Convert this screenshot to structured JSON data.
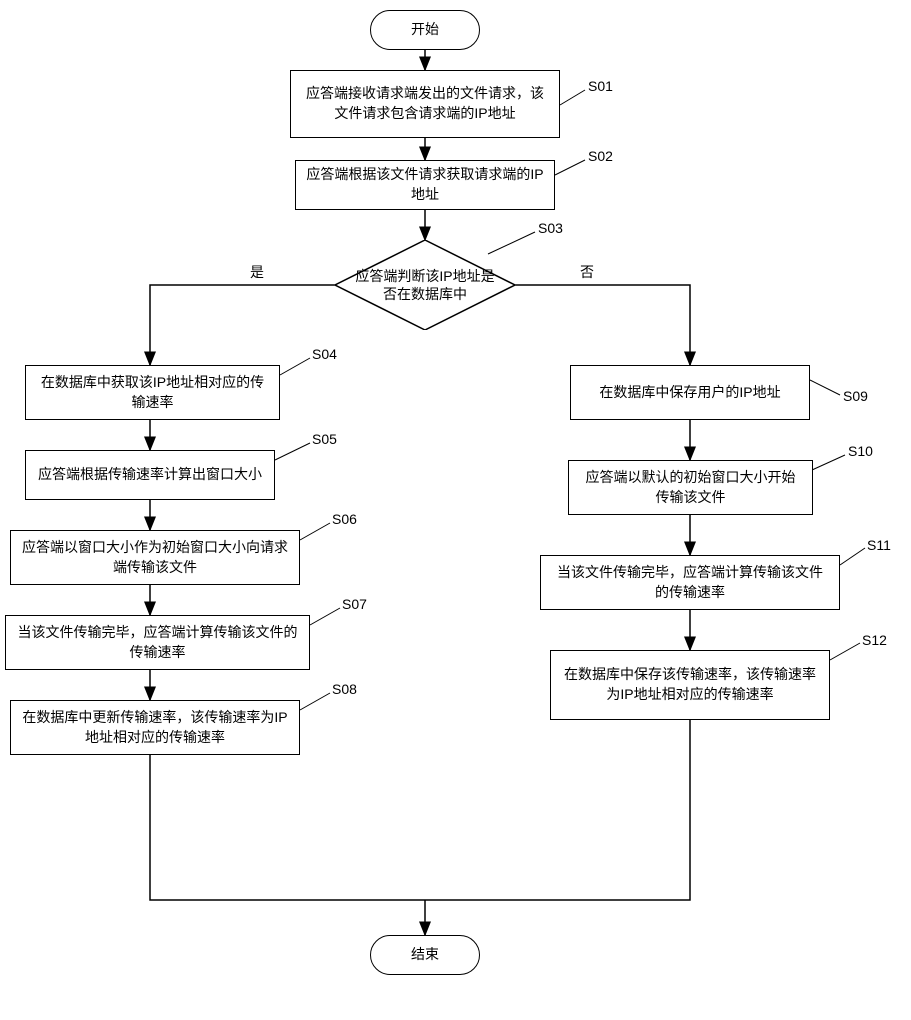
{
  "chart_data": {
    "type": "flowchart",
    "title": "",
    "nodes": [
      {
        "id": "start",
        "type": "terminator",
        "text": "开始"
      },
      {
        "id": "S01",
        "type": "process",
        "label": "S01",
        "text": "应答端接收请求端发出的文件请求，该文件请求包含请求端的IP地址"
      },
      {
        "id": "S02",
        "type": "process",
        "label": "S02",
        "text": "应答端根据该文件请求获取请求端的IP地址"
      },
      {
        "id": "S03",
        "type": "decision",
        "label": "S03",
        "text": "应答端判断该IP地址是否在数据库中",
        "yes": "是",
        "no": "否"
      },
      {
        "id": "S04",
        "type": "process",
        "label": "S04",
        "text": "在数据库中获取该IP地址相对应的传输速率"
      },
      {
        "id": "S05",
        "type": "process",
        "label": "S05",
        "text": "应答端根据传输速率计算出窗口大小"
      },
      {
        "id": "S06",
        "type": "process",
        "label": "S06",
        "text": "应答端以窗口大小作为初始窗口大小向请求端传输该文件"
      },
      {
        "id": "S07",
        "type": "process",
        "label": "S07",
        "text": "当该文件传输完毕，应答端计算传输该文件的传输速率"
      },
      {
        "id": "S08",
        "type": "process",
        "label": "S08",
        "text": "在数据库中更新传输速率，该传输速率为IP地址相对应的传输速率"
      },
      {
        "id": "S09",
        "type": "process",
        "label": "S09",
        "text": "在数据库中保存用户的IP地址"
      },
      {
        "id": "S10",
        "type": "process",
        "label": "S10",
        "text": "应答端以默认的初始窗口大小开始传输该文件"
      },
      {
        "id": "S11",
        "type": "process",
        "label": "S11",
        "text": "当该文件传输完毕，应答端计算传输该文件的传输速率"
      },
      {
        "id": "S12",
        "type": "process",
        "label": "S12",
        "text": "在数据库中保存该传输速率，该传输速率为IP地址相对应的传输速率"
      },
      {
        "id": "end",
        "type": "terminator",
        "text": "结束"
      }
    ],
    "edges": [
      {
        "from": "start",
        "to": "S01"
      },
      {
        "from": "S01",
        "to": "S02"
      },
      {
        "from": "S02",
        "to": "S03"
      },
      {
        "from": "S03",
        "to": "S04",
        "label": "是"
      },
      {
        "from": "S03",
        "to": "S09",
        "label": "否"
      },
      {
        "from": "S04",
        "to": "S05"
      },
      {
        "from": "S05",
        "to": "S06"
      },
      {
        "from": "S06",
        "to": "S07"
      },
      {
        "from": "S07",
        "to": "S08"
      },
      {
        "from": "S09",
        "to": "S10"
      },
      {
        "from": "S10",
        "to": "S11"
      },
      {
        "from": "S11",
        "to": "S12"
      },
      {
        "from": "S08",
        "to": "end"
      },
      {
        "from": "S12",
        "to": "end"
      }
    ]
  },
  "start": "开始",
  "end": "结束",
  "yes": "是",
  "no": "否",
  "S01": {
    "label": "S01",
    "text": "应答端接收请求端发出的文件请求，该文件请求包含请求端的IP地址"
  },
  "S02": {
    "label": "S02",
    "text": "应答端根据该文件请求获取请求端的IP地址"
  },
  "S03": {
    "label": "S03",
    "text": "应答端判断该IP地址是否在数据库中"
  },
  "S04": {
    "label": "S04",
    "text": "在数据库中获取该IP地址相对应的传输速率"
  },
  "S05": {
    "label": "S05",
    "text": "应答端根据传输速率计算出窗口大小"
  },
  "S06": {
    "label": "S06",
    "text": "应答端以窗口大小作为初始窗口大小向请求端传输该文件"
  },
  "S07": {
    "label": "S07",
    "text": "当该文件传输完毕，应答端计算传输该文件的传输速率"
  },
  "S08": {
    "label": "S08",
    "text": "在数据库中更新传输速率，该传输速率为IP地址相对应的传输速率"
  },
  "S09": {
    "label": "S09",
    "text": "在数据库中保存用户的IP地址"
  },
  "S10": {
    "label": "S10",
    "text": "应答端以默认的初始窗口大小开始传输该文件"
  },
  "S11": {
    "label": "S11",
    "text": "当该文件传输完毕，应答端计算传输该文件的传输速率"
  },
  "S12": {
    "label": "S12",
    "text": "在数据库中保存该传输速率，该传输速率为IP地址相对应的传输速率"
  }
}
